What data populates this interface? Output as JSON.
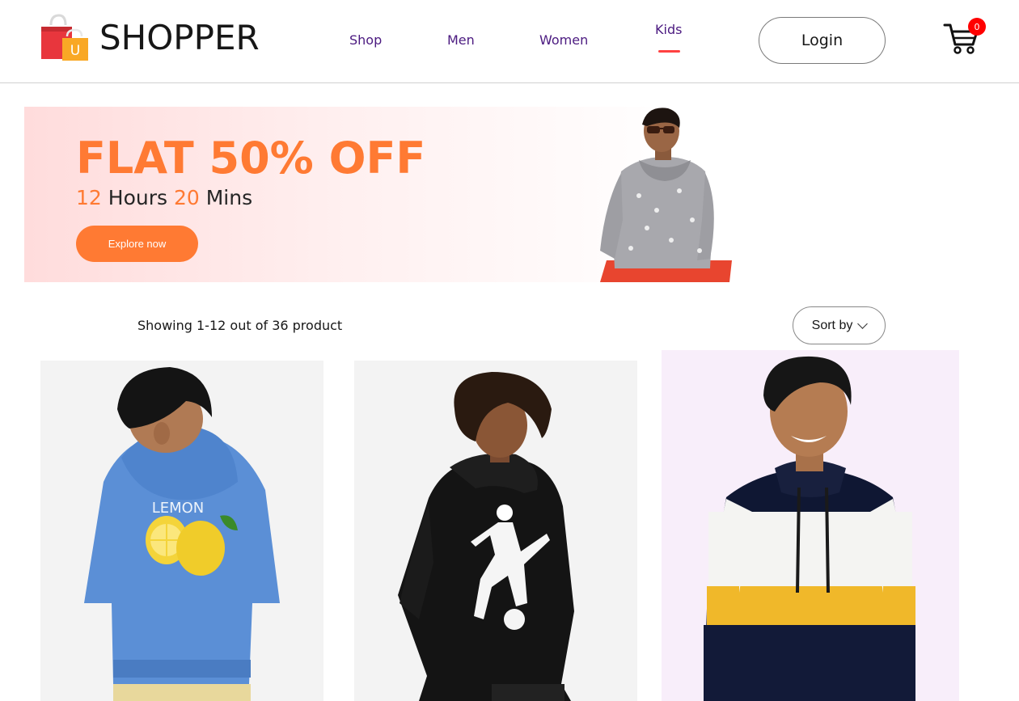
{
  "brand": {
    "name": "SHOPPER",
    "logo_letter": "U"
  },
  "nav": {
    "items": [
      {
        "label": "Shop",
        "active": false
      },
      {
        "label": "Men",
        "active": false
      },
      {
        "label": "Women",
        "active": false
      },
      {
        "label": "Kids",
        "active": true
      }
    ]
  },
  "header": {
    "login_label": "Login",
    "cart_count": "0"
  },
  "banner": {
    "title": "FLAT 50% OFF",
    "hours": "12",
    "hours_label": "Hours",
    "mins": "20",
    "mins_label": "Mins",
    "button_label": "Explore now"
  },
  "listing": {
    "results_text": "Showing 1-12 out of 36 product",
    "sort_label": "Sort by"
  },
  "products": [
    {
      "name": "blue lemon hoodie"
    },
    {
      "name": "black football hoodie"
    },
    {
      "name": "striped hoodie"
    }
  ],
  "colors": {
    "accent": "#ff7a33",
    "nav_text": "#4b1a80",
    "active_underline": "#ff4141",
    "badge": "#ff0000"
  }
}
